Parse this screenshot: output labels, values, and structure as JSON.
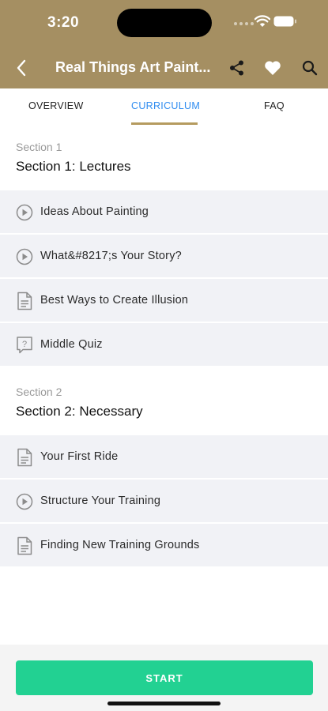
{
  "status": {
    "time": "3:20"
  },
  "app_bar": {
    "title": "Real Things Art Paint..."
  },
  "tabs": [
    {
      "label": "OVERVIEW"
    },
    {
      "label": "CURRICULUM"
    },
    {
      "label": "FAQ"
    }
  ],
  "active_tab": "CURRICULUM",
  "sections": [
    {
      "label": "Section 1",
      "title": "Section 1: Lectures",
      "lessons": [
        {
          "icon": "play-circle-icon",
          "title": "Ideas About Painting"
        },
        {
          "icon": "play-circle-icon",
          "title": "What&#8217;s Your Story?"
        },
        {
          "icon": "document-icon",
          "title": "Best Ways to Create Illusion"
        },
        {
          "icon": "quiz-icon",
          "title": "Middle Quiz"
        }
      ]
    },
    {
      "label": "Section 2",
      "title": "Section 2: Necessary",
      "lessons": [
        {
          "icon": "document-icon",
          "title": "Your First Ride"
        },
        {
          "icon": "play-circle-icon",
          "title": "Structure Your Training"
        },
        {
          "icon": "document-icon",
          "title": "Finding New Training Grounds"
        }
      ]
    }
  ],
  "footer": {
    "start_label": "START"
  },
  "colors": {
    "header": "#a58f62",
    "active_tab_text": "#2f8cf0",
    "indicator": "#b59b5f",
    "start_button": "#22d192",
    "lesson_bg": "#f1f2f6"
  }
}
